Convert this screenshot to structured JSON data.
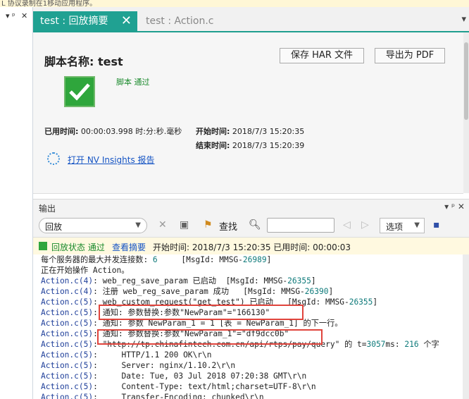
{
  "top_strip_text": "L 协议录制在1移动应用程序。",
  "left_panel": {
    "pin": "▾ ᵖ",
    "close": "✕"
  },
  "tabs": [
    {
      "label": "test : 回放摘要",
      "close": "✕",
      "active": true
    },
    {
      "label": "test : Action.c",
      "active": false
    }
  ],
  "tabbar_more": "▾",
  "summary": {
    "script_label": "脚本名称: test",
    "buttons": {
      "save_har": "保存 HAR 文件",
      "export_pdf": "导出为 PDF"
    },
    "result_status": "脚本 通过",
    "elapsed_label": "已用时间:",
    "elapsed_value": "00:00:03.998 时:分:秒.毫秒",
    "start_label": "开始时间:",
    "start_value": "2018/7/3 15:20:35",
    "end_label": "结束时间:",
    "end_value": "2018/7/3 15:20:39",
    "nv_link": "打开 NV Insights 报告"
  },
  "output": {
    "title": "输出",
    "header_controls": "▾ ᵖ ✕",
    "replay_select": "回放",
    "search_label": "查找",
    "options_label": "选项",
    "status_ok": "回放状态 通过",
    "view_summary": "查看摘要",
    "status_detail": "开始时间: 2018/7/3 15:20:35 已用时间: 00:00:03"
  },
  "log_lines": [
    [
      "",
      "每个服务器的最大并发连接数: ",
      "6",
      "     [MsgId: MMSG-",
      "26989",
      "]"
    ],
    [
      "",
      "正在开始操作 Action。",
      "",
      "",
      "",
      ""
    ],
    [
      "Action.c(4)",
      ": web_reg_save_param 已启动  [MsgId: MMSG-",
      "",
      "",
      "26355",
      "]"
    ],
    [
      "Action.c(4)",
      ": 注册 web_reg_save_param 成功   [MsgId: MMSG-",
      "",
      "",
      "26390",
      "]"
    ],
    [
      "Action.c(5)",
      ": web_custom_request(\"get_test\") 已启动   [MsgId: MMSG-",
      "",
      "",
      "26355",
      "]"
    ],
    [
      "Action.c(5)",
      ": 通知: 参数替换:参数\"NewParam\"=\"166130\"",
      "",
      "",
      "",
      ""
    ],
    [
      "Action.c(5)",
      ": 通知: 参数 NewParam_1 = 1 [表 = NewParam_1] 的下一行。",
      "",
      "",
      "",
      ""
    ],
    [
      "Action.c(5)",
      ": 通知: 参数替换:参数\"NewParam_1\"=\"df9dcc0b\"",
      "",
      "",
      "",
      ""
    ],
    [
      "Action.c(5)",
      ": \"http://tp.chinafintech.com.cn/api/rtps/pay/query\" 的 t=",
      "3057",
      "ms: ",
      "216",
      " 个字"
    ],
    [
      "Action.c(5)",
      ":     HTTP/1.1 200 OK\\r\\n",
      "",
      "",
      "",
      ""
    ],
    [
      "Action.c(5)",
      ":     Server: nginx/1.10.2\\r\\n",
      "",
      "",
      "",
      ""
    ],
    [
      "Action.c(5)",
      ":     Date: Tue, 03 Jul 2018 07:20:38 GMT\\r\\n",
      "",
      "",
      "",
      ""
    ],
    [
      "Action.c(5)",
      ":     Content-Type: text/html;charset=UTF-8\\r\\n",
      "",
      "",
      "",
      ""
    ],
    [
      "Action.c(5)",
      ":     Transfer-Encoding: chunked\\r\\n",
      "",
      "",
      "",
      ""
    ]
  ],
  "colors": {
    "accent": "#20a192",
    "pass_green": "#2fa63c",
    "link_blue": "#1554c4",
    "highlight_red": "#e0443c"
  }
}
